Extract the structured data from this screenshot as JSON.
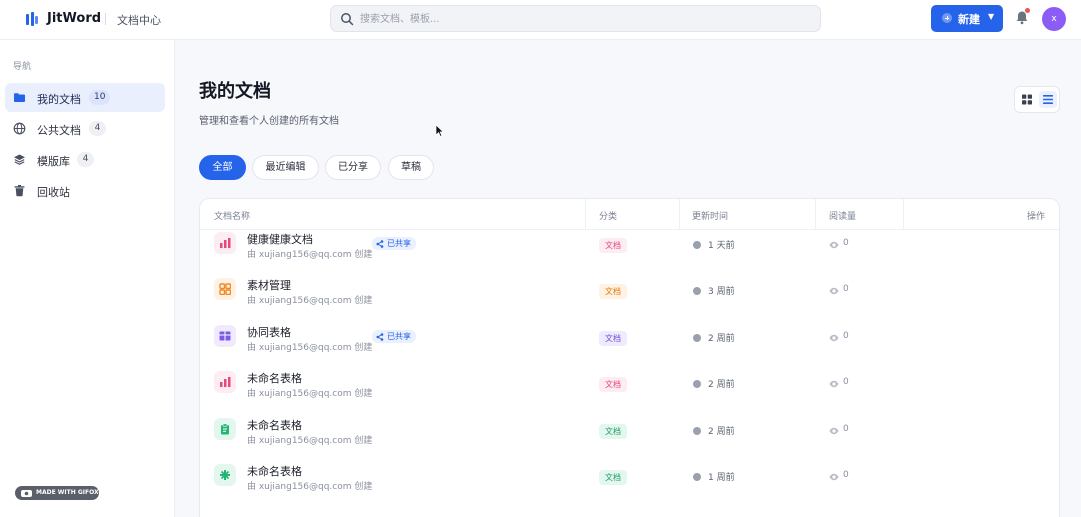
{
  "app": {
    "brand": "JitWord",
    "section": "文档中心"
  },
  "search": {
    "placeholder": "搜索文档、模板..."
  },
  "header": {
    "new_label": "新建",
    "avatar_initial": "x"
  },
  "sidebar": {
    "title": "导航",
    "items": [
      {
        "label": "我的文档",
        "count": "10",
        "icon": "folder-icon",
        "active": true
      },
      {
        "label": "公共文档",
        "count": "4",
        "icon": "globe-icon",
        "active": false
      },
      {
        "label": "模版库",
        "count": "4",
        "icon": "layers-icon",
        "active": false
      },
      {
        "label": "回收站",
        "count": "",
        "icon": "trash-icon",
        "active": false
      }
    ],
    "badge": "MADE WITH GIFOX"
  },
  "main": {
    "title": "我的文档",
    "subtitle": "管理和查看个人创建的所有文档",
    "tabs": [
      "全部",
      "最近编辑",
      "已分享",
      "草稿"
    ],
    "active_tab": "全部"
  },
  "table": {
    "columns": [
      "文档名称",
      "分类",
      "更新时间",
      "阅读量",
      "操作"
    ],
    "shared_label": "已共享",
    "rows": [
      {
        "name": "健康健康文档",
        "owner": "由 xujiang156@qq.com 创建",
        "shared": true,
        "category": "文档",
        "updated": "1 天前",
        "views": "0",
        "icon": "bar-chart-icon",
        "icon_color": "#e5487d",
        "icon_bg": "#fdecf2",
        "cat_color": "#e5487d",
        "cat_bg": "#fdecf2"
      },
      {
        "name": "素材管理",
        "owner": "由 xujiang156@qq.com 创建",
        "shared": false,
        "category": "文档",
        "updated": "3 周前",
        "views": "0",
        "icon": "grid-icon",
        "icon_color": "#f08a24",
        "icon_bg": "#fff2e2",
        "cat_color": "#e07a14",
        "cat_bg": "#fff2e2"
      },
      {
        "name": "协同表格",
        "owner": "由 xujiang156@qq.com 创建",
        "shared": true,
        "category": "文档",
        "updated": "2 周前",
        "views": "0",
        "icon": "table-icon",
        "icon_color": "#7c5ce6",
        "icon_bg": "#efeafd",
        "cat_color": "#6d4fd6",
        "cat_bg": "#efeafd"
      },
      {
        "name": "未命名表格",
        "owner": "由 xujiang156@qq.com 创建",
        "shared": false,
        "category": "文档",
        "updated": "2 周前",
        "views": "0",
        "icon": "bar-chart-icon",
        "icon_color": "#e5487d",
        "icon_bg": "#fdecf2",
        "cat_color": "#e5487d",
        "cat_bg": "#fdecf2"
      },
      {
        "name": "未命名表格",
        "owner": "由 xujiang156@qq.com 创建",
        "shared": false,
        "category": "文档",
        "updated": "2 周前",
        "views": "0",
        "icon": "clipboard-icon",
        "icon_color": "#22b573",
        "icon_bg": "#e3f7ee",
        "cat_color": "#1c9d63",
        "cat_bg": "#e3f7ee"
      },
      {
        "name": "未命名表格",
        "owner": "由 xujiang156@qq.com 创建",
        "shared": false,
        "category": "文档",
        "updated": "1 周前",
        "views": "0",
        "icon": "asterisk-icon",
        "icon_color": "#22b573",
        "icon_bg": "#e3f7ee",
        "cat_color": "#1c9d63",
        "cat_bg": "#e3f7ee"
      }
    ]
  },
  "colors": {
    "accent": "#2563eb",
    "avatar": "#8b5cf6",
    "notify": "#f05252"
  }
}
